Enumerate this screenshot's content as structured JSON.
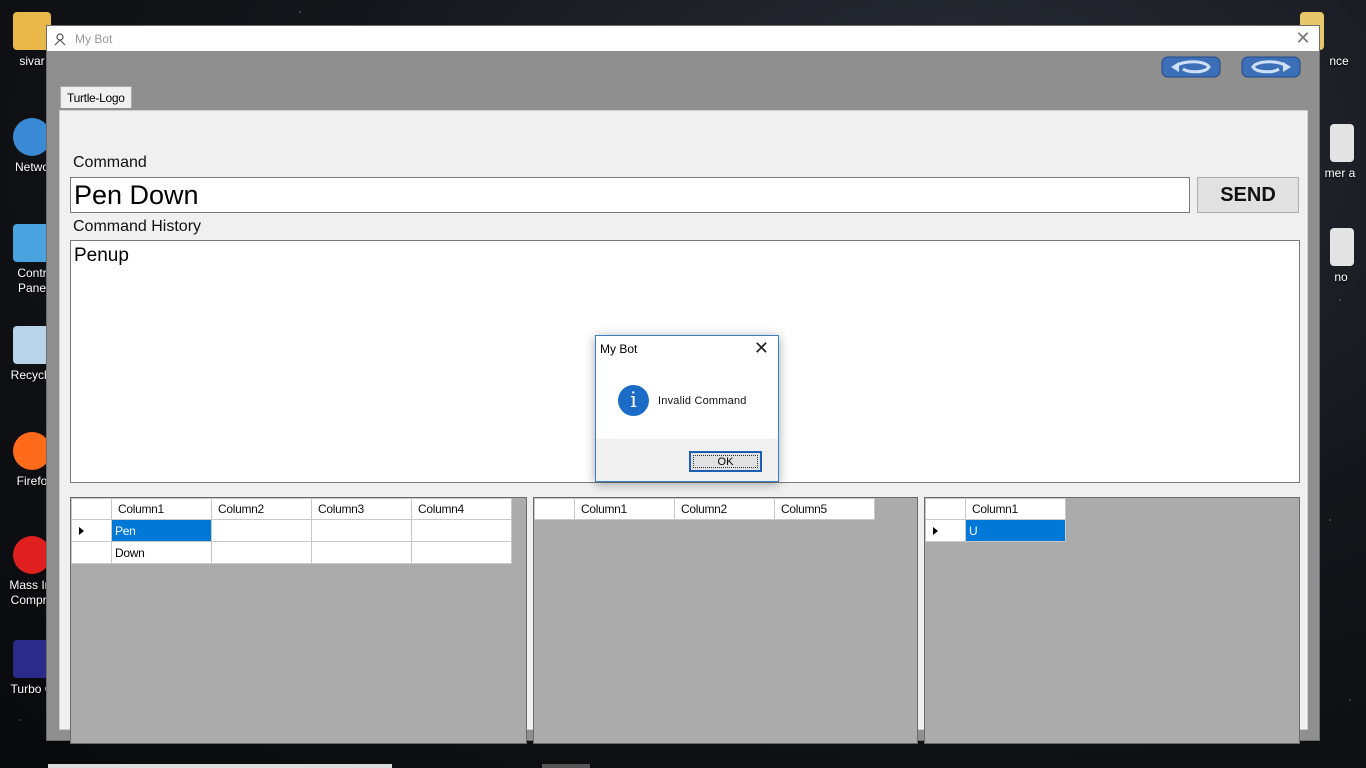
{
  "desktop": {
    "left_icons": [
      {
        "label": "sivar",
        "color": "#e8b84a"
      },
      {
        "label": "Netwo",
        "color": "#3a8ad6"
      },
      {
        "label": "Contr Pane",
        "color": "#49a3df"
      },
      {
        "label": "Recycle",
        "color": "#b9d3e8"
      },
      {
        "label": "Firefo",
        "color": "#ff6b1a"
      },
      {
        "label": "Mass Im Compre",
        "color": "#e02020"
      },
      {
        "label": "Turbo C",
        "color": "#2b2b8a"
      }
    ],
    "right_icons": [
      {
        "label": "nce",
        "color": "#e8c66a"
      },
      {
        "label": "mer a",
        "color": "#e4e4e4"
      },
      {
        "label": "no",
        "color": "#e4e4e4"
      }
    ]
  },
  "window": {
    "title": "My Bot",
    "close_glyph": "✕",
    "tab": "Turtle-Logo",
    "command_label": "Command",
    "command_value": "Pen Down",
    "send_label": "SEND",
    "history_label": "Command History",
    "history_text": "Penup"
  },
  "grid1": {
    "columns": [
      "Column1",
      "Column2",
      "Column3",
      "Column4"
    ],
    "rows": [
      [
        "Pen",
        "",
        "",
        ""
      ],
      [
        "Down",
        "",
        "",
        ""
      ]
    ]
  },
  "grid2": {
    "columns": [
      "Column1",
      "Column2",
      "Column5"
    ]
  },
  "grid3": {
    "columns": [
      "Column1"
    ],
    "rows": [
      [
        "U"
      ]
    ]
  },
  "dialog": {
    "title": "My Bot",
    "close_glyph": "✕",
    "icon_glyph": "i",
    "message": "Invalid Command",
    "ok_label": "OK"
  },
  "colors": {
    "selection": "#0078d7",
    "accent_blue": "#1a5fb4"
  }
}
